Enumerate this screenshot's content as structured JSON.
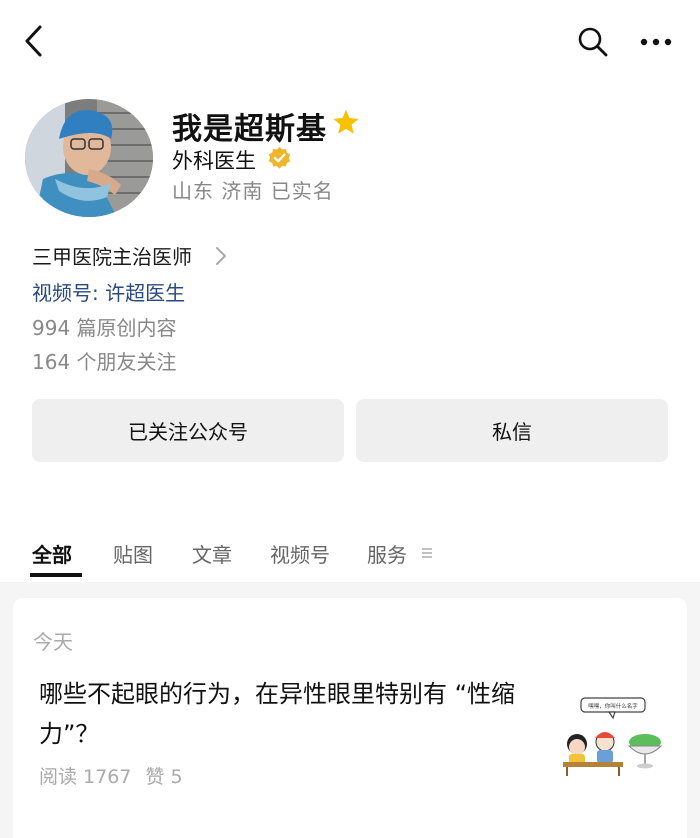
{
  "profile": {
    "name": "我是超斯基",
    "role": "外科医生",
    "location": "山东 济南 已实名",
    "hospital": "三甲医院主治医师",
    "channel": "视频号: 许超医生",
    "articles": "994 篇原创内容",
    "friends": "164 个朋友关注"
  },
  "actions": {
    "follow_label": "已关注公众号",
    "message_label": "私信"
  },
  "tabs": [
    {
      "label": "全部",
      "active": true
    },
    {
      "label": "贴图"
    },
    {
      "label": "文章"
    },
    {
      "label": "视频号"
    },
    {
      "label": "服务"
    }
  ],
  "feed": {
    "date": "今天",
    "post": {
      "title": "哪些不起眼的行为，在异性眼里特别有 “性缩力”？",
      "reads": "阅读 1767",
      "likes": "赞 5",
      "thumb_caption": "嘿嘿，你叫什么名字"
    }
  },
  "icons": {
    "back": "chevron-left-icon",
    "search": "search-icon",
    "more": "more-dots-icon",
    "star": "star-icon",
    "verified": "verified-badge-icon"
  },
  "colors": {
    "star": "#f7c100",
    "verified": "#f0b62b",
    "channel_link": "#2a4a7f"
  }
}
